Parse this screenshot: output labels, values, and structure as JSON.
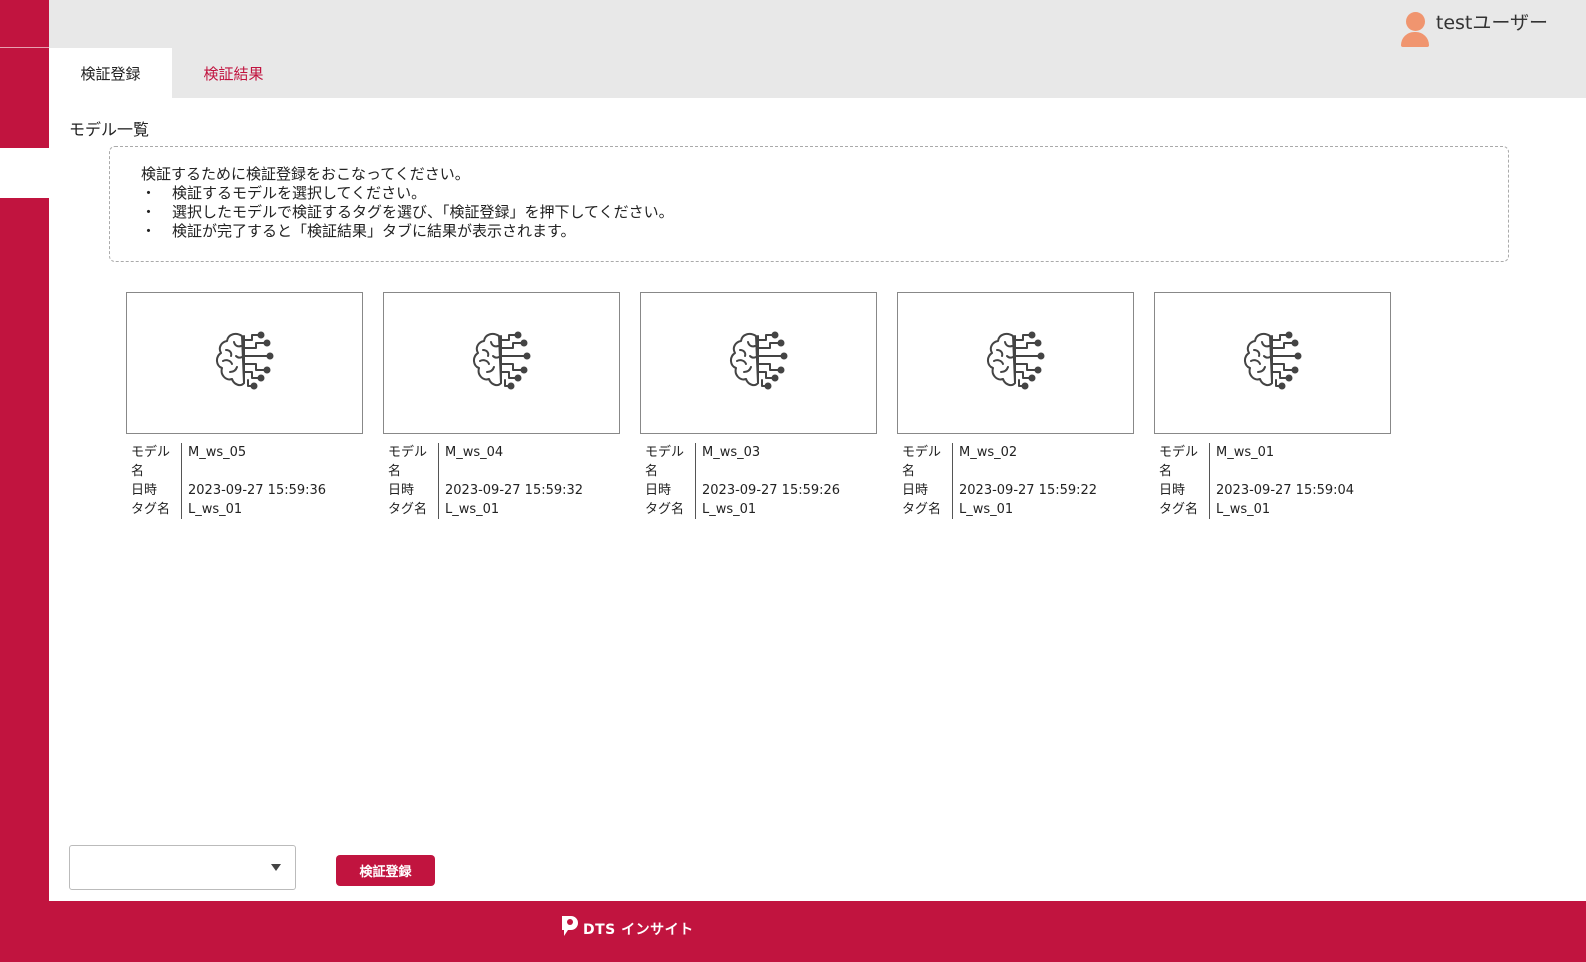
{
  "header": {
    "user_name": "testユーザー"
  },
  "tabs": [
    {
      "label": "検証登録",
      "active": true
    },
    {
      "label": "検証結果",
      "active": false
    }
  ],
  "section_title": "モデル一覧",
  "notice": {
    "intro": "検証するために検証登録をおこなってください。",
    "bullet": "・",
    "items": [
      "検証するモデルを選択してください。",
      "選択したモデルで検証するタグを選び、「検証登録」を押下してください。",
      "検証が完了すると「検証結果」タブに結果が表示されます。"
    ]
  },
  "labels": {
    "model_name": "モデル名",
    "datetime": "日時",
    "tag_name": "タグ名"
  },
  "models": [
    {
      "name": "M_ws_05",
      "datetime": "2023-09-27 15:59:36",
      "tag": "L_ws_01"
    },
    {
      "name": "M_ws_04",
      "datetime": "2023-09-27 15:59:32",
      "tag": "L_ws_01"
    },
    {
      "name": "M_ws_03",
      "datetime": "2023-09-27 15:59:26",
      "tag": "L_ws_01"
    },
    {
      "name": "M_ws_02",
      "datetime": "2023-09-27 15:59:22",
      "tag": "L_ws_01"
    },
    {
      "name": "M_ws_01",
      "datetime": "2023-09-27 15:59:04",
      "tag": "L_ws_01"
    }
  ],
  "tag_select": {
    "value": ""
  },
  "register_button": "検証登録",
  "footer": {
    "logo_text": "DTS インサイト"
  },
  "colors": {
    "accent": "#c1143f",
    "avatar": "#f0956f"
  },
  "icons": {
    "model_card": "brain-circuit-icon",
    "user": "user-avatar-icon"
  }
}
